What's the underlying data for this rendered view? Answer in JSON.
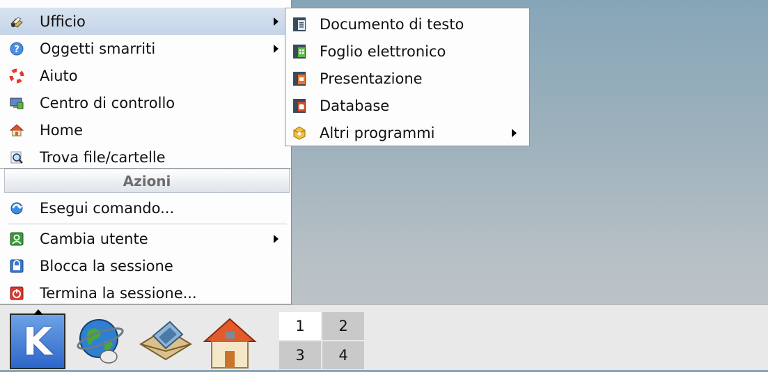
{
  "menu": {
    "items": [
      {
        "label": "Ufficio",
        "icon": "office-icon",
        "submenu": true,
        "active": true
      },
      {
        "label": "Oggetti smarriti",
        "icon": "help-question-icon",
        "submenu": true
      },
      {
        "label": "Aiuto",
        "icon": "lifebuoy-icon",
        "submenu": false
      },
      {
        "label": "Centro di controllo",
        "icon": "control-center-icon",
        "submenu": false
      },
      {
        "label": "Home",
        "icon": "home-icon",
        "submenu": false
      },
      {
        "label": "Trova file/cartelle",
        "icon": "find-files-icon",
        "submenu": false
      }
    ],
    "section_title": "Azioni",
    "actions": [
      {
        "label": "Esegui comando...",
        "icon": "run-command-icon",
        "submenu": false
      },
      {
        "label": "Cambia utente",
        "icon": "switch-user-icon",
        "submenu": true
      },
      {
        "label": "Blocca la sessione",
        "icon": "lock-session-icon",
        "submenu": false
      },
      {
        "label": "Termina la sessione...",
        "icon": "logout-icon",
        "submenu": false
      }
    ]
  },
  "submenu": {
    "items": [
      {
        "label": "Documento di testo",
        "icon": "writer-document-icon"
      },
      {
        "label": "Foglio elettronico",
        "icon": "calc-spreadsheet-icon"
      },
      {
        "label": "Presentazione",
        "icon": "impress-presentation-icon"
      },
      {
        "label": "Database",
        "icon": "base-database-icon"
      },
      {
        "label": "Altri programmi",
        "icon": "more-programs-icon",
        "submenu": true
      }
    ]
  },
  "taskbar": {
    "launchers": [
      "kde-menu-icon",
      "web-browser-icon",
      "mail-client-icon",
      "home-folder-icon"
    ],
    "pager": [
      "1",
      "2",
      "3",
      "4"
    ],
    "current_desktop": "1"
  },
  "colors": {
    "highlight": "#c4d4e6",
    "kde_blue": "#2d66c9",
    "desktop": "#8fa9b8"
  }
}
